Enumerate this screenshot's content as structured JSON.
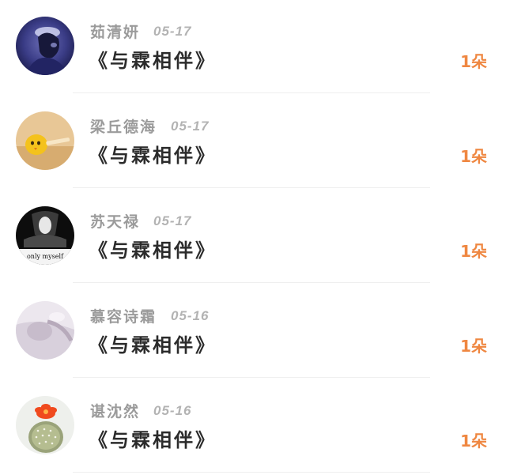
{
  "entries": [
    {
      "name": "茹清妍",
      "date": "05-17",
      "title": "《与霖相伴》",
      "count": "1朵",
      "avatar": "dark-figure-avatar"
    },
    {
      "name": "梁丘德海",
      "date": "05-17",
      "title": "《与霖相伴》",
      "count": "1朵",
      "avatar": "yellow-chick-avatar"
    },
    {
      "name": "苏天禄",
      "date": "05-17",
      "title": "《与霖相伴》",
      "count": "1朵",
      "avatar": "only-myself-avatar",
      "avatar_caption": "only myself"
    },
    {
      "name": "慕容诗霜",
      "date": "05-16",
      "title": "《与霖相伴》",
      "count": "1朵",
      "avatar": "soft-portrait-avatar"
    },
    {
      "name": "谌沈然",
      "date": "05-16",
      "title": "《与霖相伴》",
      "count": "1朵",
      "avatar": "cactus-flower-avatar"
    }
  ],
  "colors": {
    "name": "#9b9b9b",
    "date": "#b3b3b3",
    "title": "#2b2b2b",
    "count": "#ef8741",
    "divider": "#efefef"
  }
}
